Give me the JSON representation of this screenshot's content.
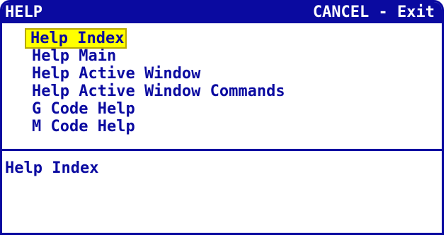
{
  "window": {
    "title": "HELP",
    "cancel_hint": "CANCEL - Exit"
  },
  "menu": {
    "selected_index": 0,
    "items": [
      {
        "label": "Help Index"
      },
      {
        "label": "Help Main"
      },
      {
        "label": "Help Active Window"
      },
      {
        "label": "Help Active Window Commands"
      },
      {
        "label": "G Code Help"
      },
      {
        "label": "M Code Help"
      }
    ]
  },
  "description": {
    "text": "Help Index"
  },
  "colors": {
    "frame": "#0a0aa0",
    "text": "#0a0aa0",
    "highlight": "#ffff00",
    "background": "#ffffff"
  }
}
